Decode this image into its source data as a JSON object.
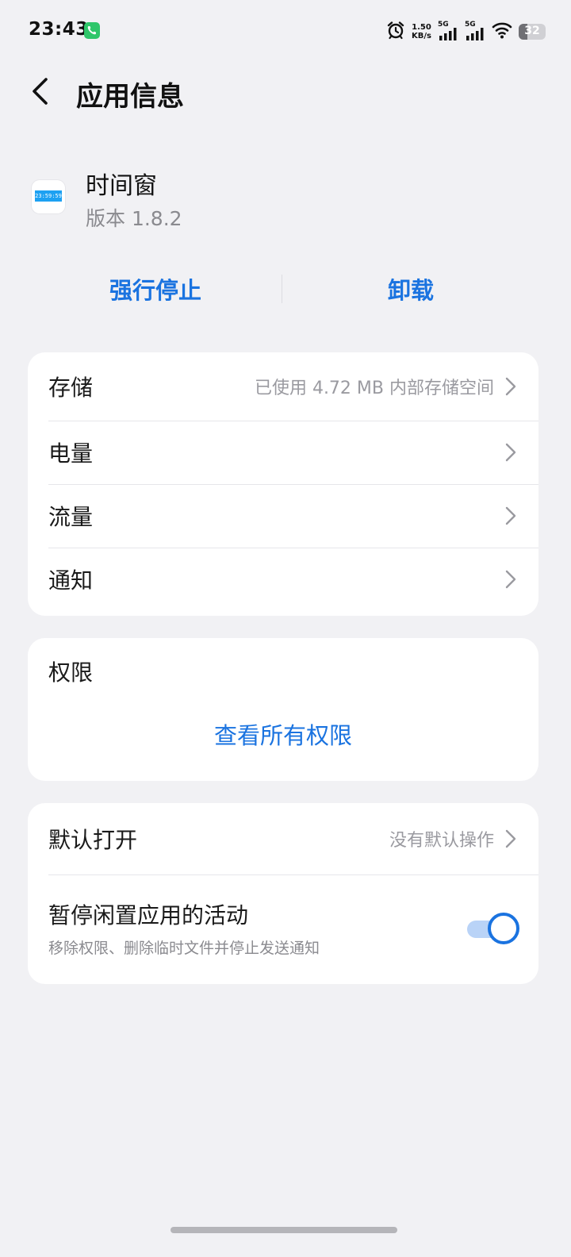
{
  "status_bar": {
    "time": "23:43",
    "net_speed": "1.50",
    "net_unit": "KB/s",
    "sim1": "5G",
    "sim2": "5G",
    "battery": "32",
    "battery_level": 0.32,
    "call_color": "#2fc66a"
  },
  "header": {
    "title": "应用信息"
  },
  "app": {
    "name": "时间窗",
    "version": "版本 1.8.2",
    "icon_text": "23:59:59"
  },
  "actions": {
    "force_stop": "强行停止",
    "uninstall": "卸载"
  },
  "info_rows": [
    {
      "label": "存储",
      "value": "已使用 4.72 MB 内部存储空间"
    },
    {
      "label": "电量",
      "value": ""
    },
    {
      "label": "流量",
      "value": ""
    },
    {
      "label": "通知",
      "value": ""
    }
  ],
  "permissions": {
    "title": "权限",
    "link": "查看所有权限"
  },
  "defaults": {
    "open_label": "默认打开",
    "open_value": "没有默认操作",
    "pause_label": "暂停闲置应用的活动",
    "pause_desc": "移除权限、删除临时文件并停止发送通知",
    "pause_enabled": true
  },
  "colors": {
    "accent": "#1a73e0",
    "background": "#f1f1f4",
    "card": "#ffffff"
  }
}
